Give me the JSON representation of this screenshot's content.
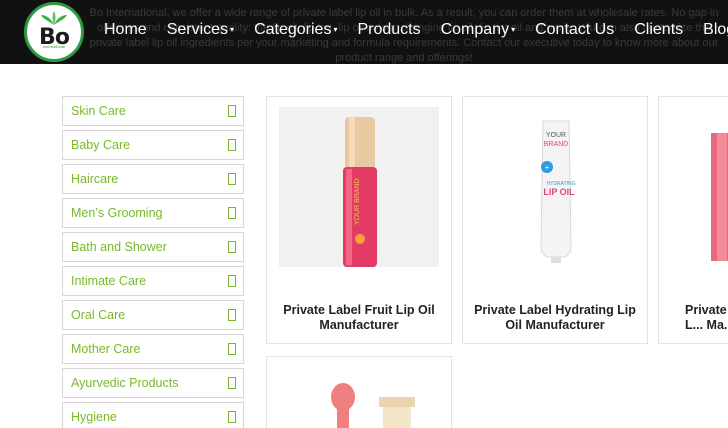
{
  "header": {
    "intro_text": "Bo International, we offer a wide range of private label lip oil in bulk. As a result, you can order them at wholesale rates. No gap in offerings and consistent quality: the lip oil, lip tint, lip oil colour-changing lip oil, lip tint oil and more. You can also customize the private label lip oil ingredients per your marketing and formula requirements. Contact our executive today to know more about our product range and offerings!",
    "logo_text": "Bo",
    "logo_subtext": "International",
    "nav": [
      {
        "label": "Home",
        "dropdown": false
      },
      {
        "label": "Services",
        "dropdown": true
      },
      {
        "label": "Categories",
        "dropdown": true
      },
      {
        "label": "Products",
        "dropdown": false
      },
      {
        "label": "Company",
        "dropdown": true
      },
      {
        "label": "Contact Us",
        "dropdown": false
      },
      {
        "label": "Clients",
        "dropdown": false
      },
      {
        "label": "Blogs",
        "dropdown": true
      }
    ]
  },
  "sidebar": {
    "categories": [
      {
        "label": "Skin Care"
      },
      {
        "label": "Baby Care"
      },
      {
        "label": "Haircare"
      },
      {
        "label": "Men’s Grooming"
      },
      {
        "label": "Bath and Shower"
      },
      {
        "label": "Intimate Care"
      },
      {
        "label": "Oral Care"
      },
      {
        "label": "Mother Care"
      },
      {
        "label": "Ayurvedic Products"
      },
      {
        "label": "Hygiene"
      }
    ]
  },
  "products": [
    {
      "title": "Private Label Fruit Lip Oil Manufacturer",
      "label": "YOUR BRAND"
    },
    {
      "title": "Private Label Hydrating Lip Oil Manufacturer",
      "brand_top": "YOUR",
      "brand_bottom": "BRAND",
      "product_line": "HYDRATING",
      "product_name": "LIP OIL"
    },
    {
      "title": "Private L... Ma..."
    },
    {
      "title": ""
    }
  ],
  "colors": {
    "header_bg": "#111111",
    "accent_green": "#79b82a",
    "logo_green": "#2e9a3e"
  }
}
